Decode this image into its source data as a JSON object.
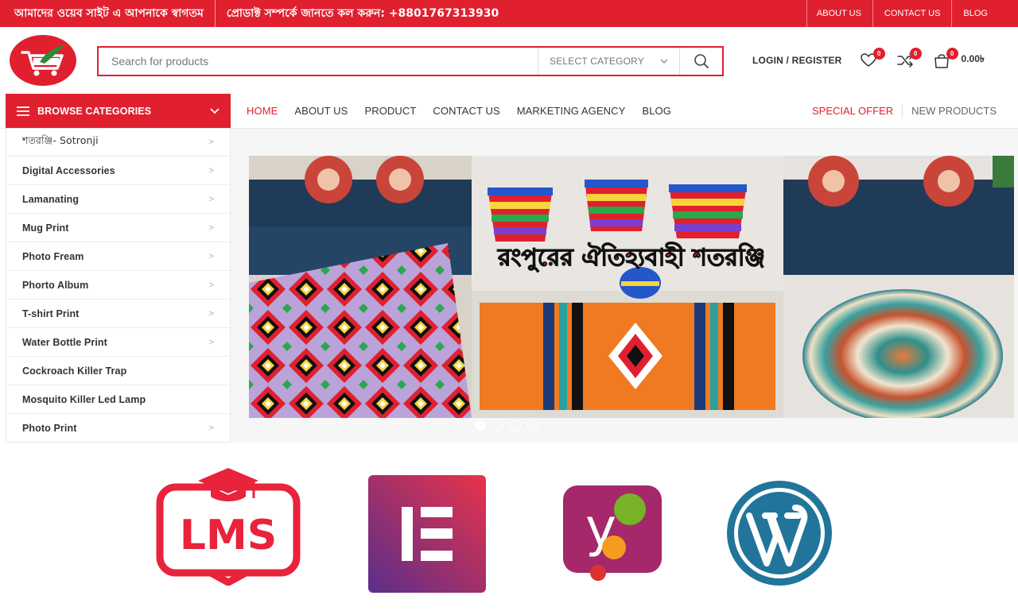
{
  "topbar": {
    "welcome": "আমাদের ওয়েব সাইট এ আপনাকে স্বাগতম",
    "call": "প্রোডাক্ট সম্পর্কে জানতে কল করুন: +8801767313930",
    "links": [
      "ABOUT US",
      "CONTACT US",
      "BLOG"
    ]
  },
  "header": {
    "search_placeholder": "Search for products",
    "select_category": "SELECT CATEGORY",
    "login": "LOGIN / REGISTER",
    "wishlist_count": "0",
    "compare_count": "0",
    "cart_count": "0",
    "cart_total": "0.00৳"
  },
  "nav": {
    "browse_label": "BROWSE CATEGORIES",
    "main": [
      "HOME",
      "ABOUT US",
      "PRODUCT",
      "CONTACT US",
      "MARKETING AGENCY",
      "BLOG"
    ],
    "special_offer": "SPECIAL OFFER",
    "new_products": "NEW PRODUCTS"
  },
  "categories": [
    "শতরঞ্জি- Sotronji",
    "Digital Accessories",
    "Lamanating",
    "Mug Print",
    "Photo Fream",
    "Phorto Album",
    "T-shirt Print",
    "Water Bottle Print",
    "Cockroach Killer Trap",
    "Mosquito Killer Led Lamp",
    "Photo Print"
  ],
  "banner": {
    "headline": "রংপুরের ঐতিহ্যবাহী শতরঞ্জি",
    "slide_count": 4,
    "active_slide": 1
  },
  "logos": {
    "lms_text": "LMS"
  },
  "colors": {
    "brand_red": "#e0202f",
    "elementor": "#92003b",
    "wordpress": "#21759b"
  }
}
